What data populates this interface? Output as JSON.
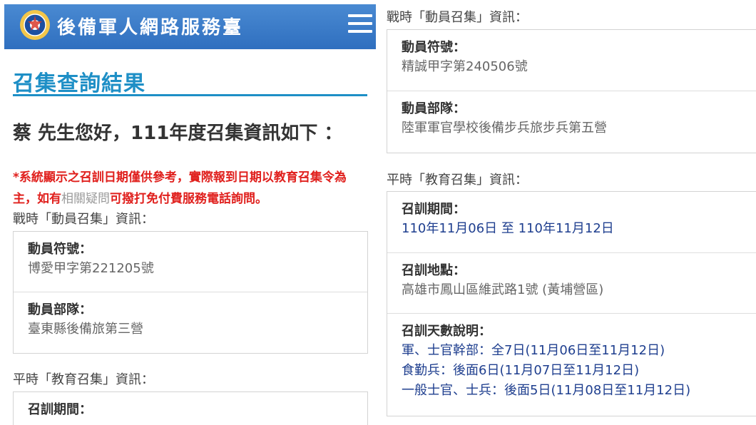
{
  "header": {
    "site_title": "後備軍人網路服務臺",
    "logo_icon": "emblem-logo-icon",
    "menu_icon": "hamburger-menu-icon",
    "bg_color": "#3a7bc8"
  },
  "left": {
    "page_title": "召集查詢結果",
    "greeting": "蔡 先生您好，111年度召集資訊如下 ：",
    "notice_part1": "*系統顯示之召訓日期僅供參考，實際報到日期以教育召集令為主，如有",
    "notice_link": "相關疑問",
    "notice_part2": "可撥打免付費服務電話詢問。",
    "wartime_heading": "戰時「動員召集」資訊：",
    "wartime": {
      "code_label": "動員符號：",
      "code_value": "博愛甲字第221205號",
      "unit_label": "動員部隊：",
      "unit_value": "臺東縣後備旅第三營"
    },
    "peacetime_heading": "平時「教育召集」資訊：",
    "period_label": "召訓期間："
  },
  "right": {
    "wartime_heading": "戰時「動員召集」資訊：",
    "wartime": {
      "code_label": "動員符號：",
      "code_value": "精誠甲字第240506號",
      "unit_label": "動員部隊：",
      "unit_value": "陸軍軍官學校後備步兵旅步兵第五營"
    },
    "peacetime_heading": "平時「教育召集」資訊：",
    "peacetime": {
      "period_label": "召訓期間：",
      "period_value": "110年11月06日 至 110年11月12日",
      "location_label": "召訓地點：",
      "location_value": "高雄市鳳山區維武路1號 (黃埔營區)",
      "days_label": "召訓天數說明：",
      "days_lines": [
        "軍、士官幹部：全7日(11月06日至11月12日)",
        "食勤兵：後面6日(11月07日至11月12日)",
        "一般士官、士兵：後面5日(11月08日至11月12日)"
      ]
    }
  },
  "colors": {
    "accent": "#1e8fc6",
    "notice": "#e0201d",
    "value_blue": "#1f3f8f"
  }
}
